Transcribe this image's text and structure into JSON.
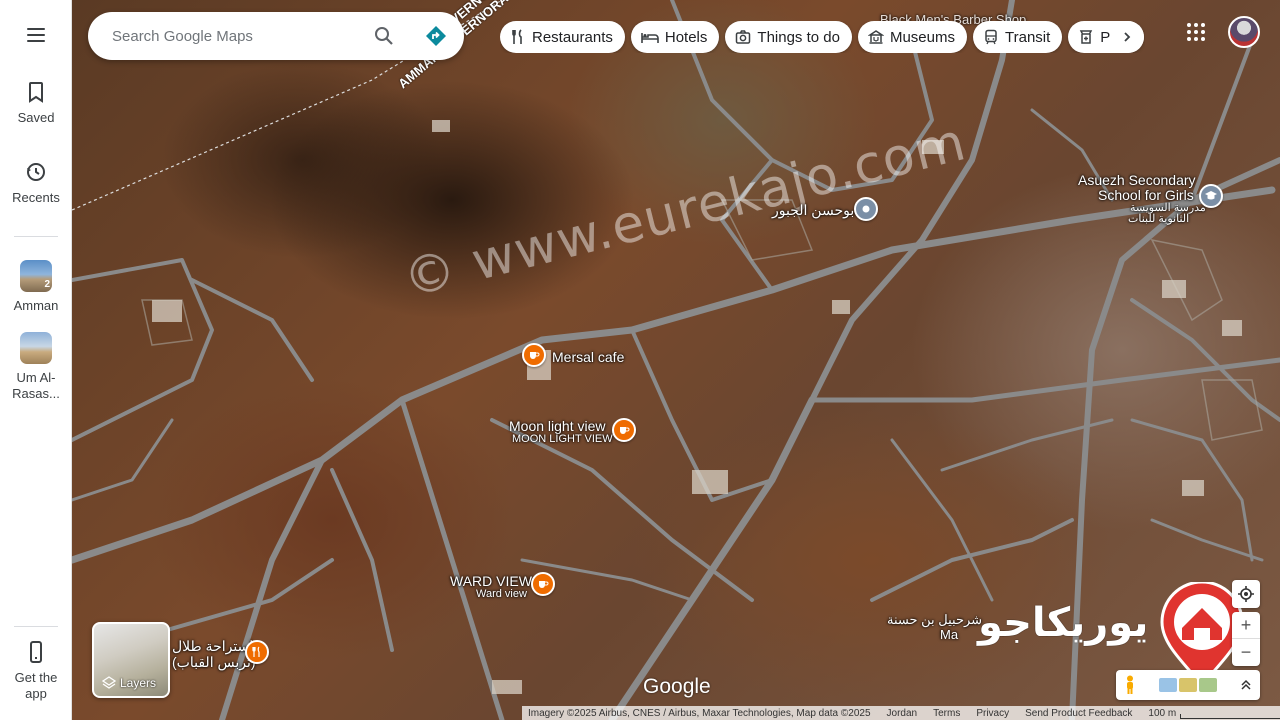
{
  "rail": {
    "saved_label": "Saved",
    "recents_label": "Recents",
    "recent_places": [
      {
        "label": "Amman",
        "badge": "2"
      },
      {
        "label": "Um Al-\nRasas..."
      }
    ],
    "get_app_label": "Get the\napp"
  },
  "search": {
    "placeholder": "Search Google Maps"
  },
  "chips": [
    {
      "label": "Restaurants",
      "icon": "fork-knife-icon"
    },
    {
      "label": "Hotels",
      "icon": "bed-icon"
    },
    {
      "label": "Things to do",
      "icon": "camera-icon"
    },
    {
      "label": "Museums",
      "icon": "museum-icon"
    },
    {
      "label": "Transit",
      "icon": "train-icon"
    },
    {
      "label": "Phar",
      "icon": "pharmacy-icon"
    }
  ],
  "map": {
    "road_labels": {
      "governorate_1": "AMMAN GOVERNORATE",
      "governorate_2": "VERNO"
    },
    "top_place": "Black Men's Barber Shop",
    "places": {
      "abu_hasan": "ابوحسن الجبور",
      "school_line1": "Asuezh Secondary",
      "school_line2": "School for Girls",
      "school_ar1": "مدرسة السويسة",
      "school_ar2": "الثانوية للبنات",
      "mersal": "Mersal cafe",
      "moon_en": "Moon light view",
      "moon_caps": "MOON LIGHT VIEW",
      "ward_caps": "WARD VIEW",
      "ward_en": "Ward view",
      "rest_ar1": "استراحة طلال",
      "rest_ar2": "(تربس القباب)",
      "sharhabeel": "شرحبيل بن حسنة",
      "sharhabeel_2": "Ma"
    },
    "watermark": "© www.eurekajo.com",
    "brand_text": "يوريكاجو"
  },
  "layers": {
    "label": "Layers"
  },
  "google_logo": "Google",
  "footer": {
    "imagery": "Imagery ©2025 Airbus, CNES / Airbus, Maxar Technologies, Map data ©2025",
    "country": "Jordan",
    "terms": "Terms",
    "privacy": "Privacy",
    "feedback": "Send Product Feedback",
    "scale": "100 m"
  },
  "colors": {
    "poi_orange": "#ef6c00",
    "school_pin": "#7b8fa6",
    "brand_red": "#e0342f",
    "directions_blue": "#0b8a9d"
  }
}
